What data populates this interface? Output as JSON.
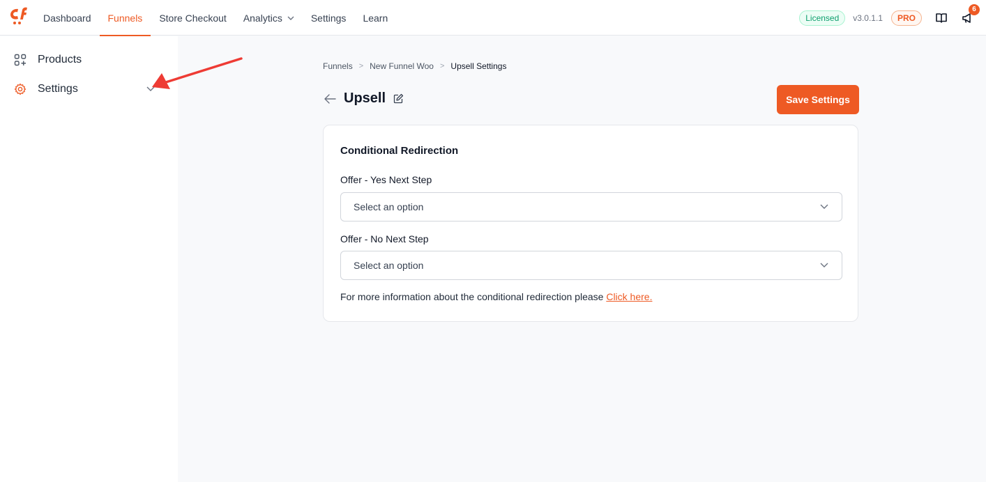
{
  "colors": {
    "accent": "#ee5a24",
    "licensed": "#0e9f6e",
    "annotation_arrow": "#ee3b34"
  },
  "topnav": {
    "logo_icon": "cartflows-logo-icon",
    "links": [
      {
        "label": "Dashboard"
      },
      {
        "label": "Funnels",
        "active": true
      },
      {
        "label": "Store Checkout"
      },
      {
        "label": "Analytics",
        "has_dropdown": true
      },
      {
        "label": "Settings"
      },
      {
        "label": "Learn"
      }
    ],
    "licensed_badge": "Licensed",
    "version": "v3.0.1.1",
    "pro_badge": "PRO",
    "docs_icon": "book-open-icon",
    "announcements_icon": "megaphone-icon",
    "notification_count": "6"
  },
  "sidebar": {
    "items": [
      {
        "label": "Products",
        "icon": "grid-plus-icon"
      },
      {
        "label": "Settings",
        "icon": "gear-icon",
        "expandable": true
      }
    ]
  },
  "breadcrumb": {
    "items": [
      "Funnels",
      "New Funnel Woo",
      "Upsell Settings"
    ],
    "separator": ">"
  },
  "page": {
    "title": "Upsell",
    "save_button": "Save Settings"
  },
  "card": {
    "title": "Conditional Redirection",
    "fields": [
      {
        "label": "Offer - Yes Next Step",
        "value": "Select an option"
      },
      {
        "label": "Offer - No Next Step",
        "value": "Select an option"
      }
    ],
    "info_text": "For more information about the conditional redirection please ",
    "info_link": "Click here."
  }
}
